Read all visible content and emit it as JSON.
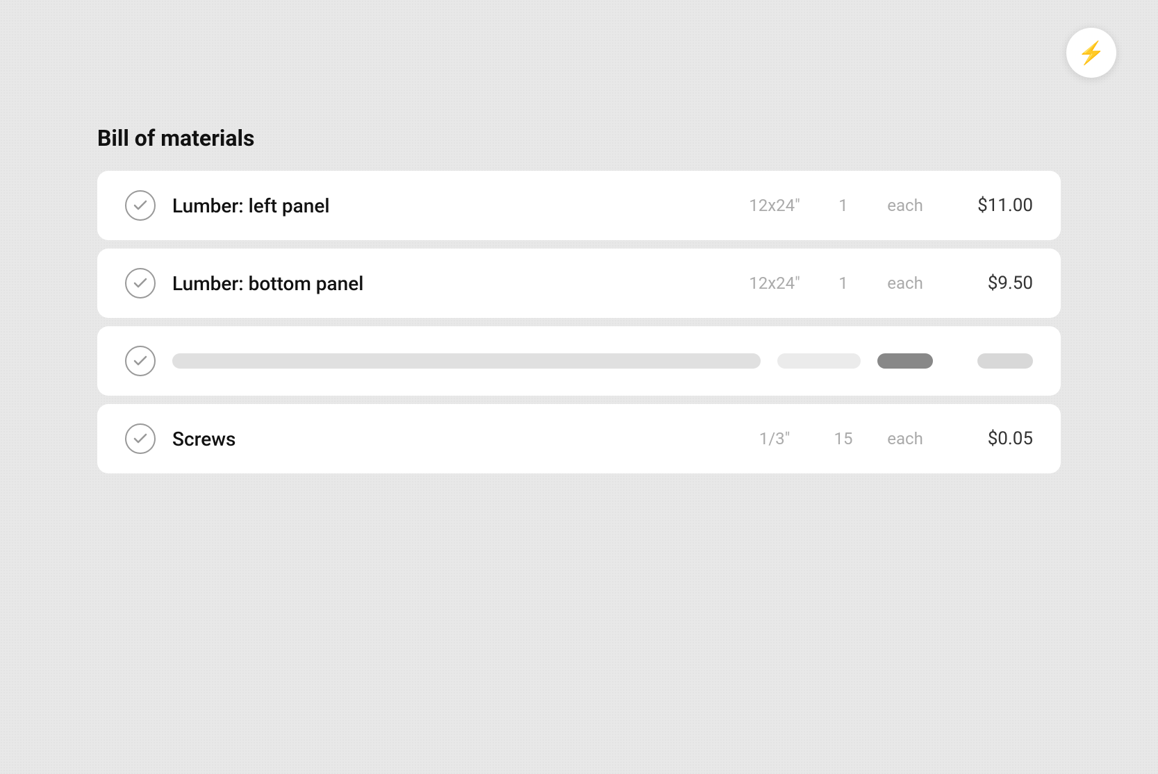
{
  "app": {
    "lightning_button_label": "⚡"
  },
  "page": {
    "title": "Bill of materials"
  },
  "items": [
    {
      "id": "item-1",
      "name": "Lumber: left panel",
      "dimension": "12x24\"",
      "quantity": "1",
      "unit": "each",
      "price": "$11.00",
      "loading": false
    },
    {
      "id": "item-2",
      "name": "Lumber: bottom panel",
      "dimension": "12x24\"",
      "quantity": "1",
      "unit": "each",
      "price": "$9.50",
      "loading": false
    },
    {
      "id": "item-3",
      "name": "",
      "dimension": "",
      "quantity": "",
      "unit": "",
      "price": "",
      "loading": true
    },
    {
      "id": "item-4",
      "name": "Screws",
      "dimension": "1/3\"",
      "quantity": "15",
      "unit": "each",
      "price": "$0.05",
      "loading": false
    }
  ]
}
